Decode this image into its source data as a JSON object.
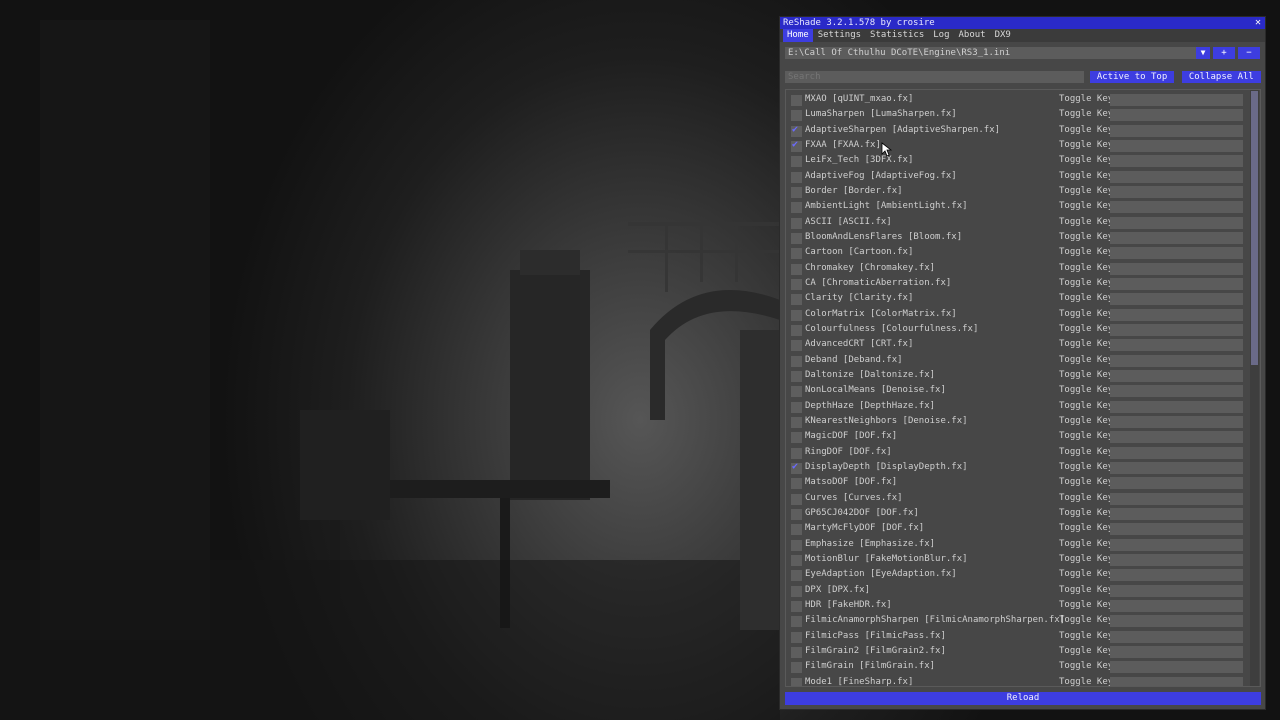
{
  "window": {
    "title": "ReShade 3.2.1.578 by crosire",
    "close_glyph": "✕"
  },
  "menu": [
    "Home",
    "Settings",
    "Statistics",
    "Log",
    "About",
    "DX9"
  ],
  "preset": {
    "path": "E:\\Call Of Cthulhu DCoTE\\Engine\\RS3_1.ini",
    "dropdown_glyph": "▼",
    "add_label": "+",
    "remove_label": "−"
  },
  "search": {
    "placeholder": "Search"
  },
  "buttons": {
    "active_to_top": "Active to Top",
    "collapse_all": "Collapse All",
    "reload": "Reload"
  },
  "toggle_key_label": "Toggle Key",
  "scrollbar": {
    "thumb_fraction": 0.46
  },
  "effects": [
    {
      "name": "MXAO [qUINT_mxao.fx]",
      "enabled": false
    },
    {
      "name": "LumaSharpen [LumaSharpen.fx]",
      "enabled": false
    },
    {
      "name": "AdaptiveSharpen [AdaptiveSharpen.fx]",
      "enabled": true
    },
    {
      "name": "FXAA [FXAA.fx]",
      "enabled": true
    },
    {
      "name": "LeiFx_Tech [3DFX.fx]",
      "enabled": false
    },
    {
      "name": "AdaptiveFog [AdaptiveFog.fx]",
      "enabled": false
    },
    {
      "name": "Border [Border.fx]",
      "enabled": false
    },
    {
      "name": "AmbientLight [AmbientLight.fx]",
      "enabled": false
    },
    {
      "name": "ASCII [ASCII.fx]",
      "enabled": false
    },
    {
      "name": "BloomAndLensFlares [Bloom.fx]",
      "enabled": false
    },
    {
      "name": "Cartoon [Cartoon.fx]",
      "enabled": false
    },
    {
      "name": "Chromakey [Chromakey.fx]",
      "enabled": false
    },
    {
      "name": "CA [ChromaticAberration.fx]",
      "enabled": false
    },
    {
      "name": "Clarity [Clarity.fx]",
      "enabled": false
    },
    {
      "name": "ColorMatrix [ColorMatrix.fx]",
      "enabled": false
    },
    {
      "name": "Colourfulness [Colourfulness.fx]",
      "enabled": false
    },
    {
      "name": "AdvancedCRT [CRT.fx]",
      "enabled": false
    },
    {
      "name": "Deband [Deband.fx]",
      "enabled": false
    },
    {
      "name": "Daltonize [Daltonize.fx]",
      "enabled": false
    },
    {
      "name": "NonLocalMeans [Denoise.fx]",
      "enabled": false
    },
    {
      "name": "DepthHaze [DepthHaze.fx]",
      "enabled": false
    },
    {
      "name": "KNearestNeighbors [Denoise.fx]",
      "enabled": false
    },
    {
      "name": "MagicDOF [DOF.fx]",
      "enabled": false
    },
    {
      "name": "RingDOF [DOF.fx]",
      "enabled": false
    },
    {
      "name": "DisplayDepth [DisplayDepth.fx]",
      "enabled": true
    },
    {
      "name": "MatsoDOF [DOF.fx]",
      "enabled": false
    },
    {
      "name": "Curves [Curves.fx]",
      "enabled": false
    },
    {
      "name": "GP65CJ042DOF [DOF.fx]",
      "enabled": false
    },
    {
      "name": "MartyMcFlyDOF [DOF.fx]",
      "enabled": false
    },
    {
      "name": "Emphasize [Emphasize.fx]",
      "enabled": false
    },
    {
      "name": "MotionBlur [FakeMotionBlur.fx]",
      "enabled": false
    },
    {
      "name": "EyeAdaption [EyeAdaption.fx]",
      "enabled": false
    },
    {
      "name": "DPX [DPX.fx]",
      "enabled": false
    },
    {
      "name": "HDR [FakeHDR.fx]",
      "enabled": false
    },
    {
      "name": "FilmicAnamorphSharpen [FilmicAnamorphSharpen.fx]",
      "enabled": false
    },
    {
      "name": "FilmicPass [FilmicPass.fx]",
      "enabled": false
    },
    {
      "name": "FilmGrain2 [FilmGrain2.fx]",
      "enabled": false
    },
    {
      "name": "FilmGrain [FilmGrain.fx]",
      "enabled": false
    },
    {
      "name": "Mode1 [FineSharp.fx]",
      "enabled": false
    }
  ],
  "colors": {
    "accent": "#3d3de0",
    "titlebar": "#2a2ac8",
    "panel": "#474747",
    "field": "#5c5c5c",
    "check": "#6a6aff"
  }
}
